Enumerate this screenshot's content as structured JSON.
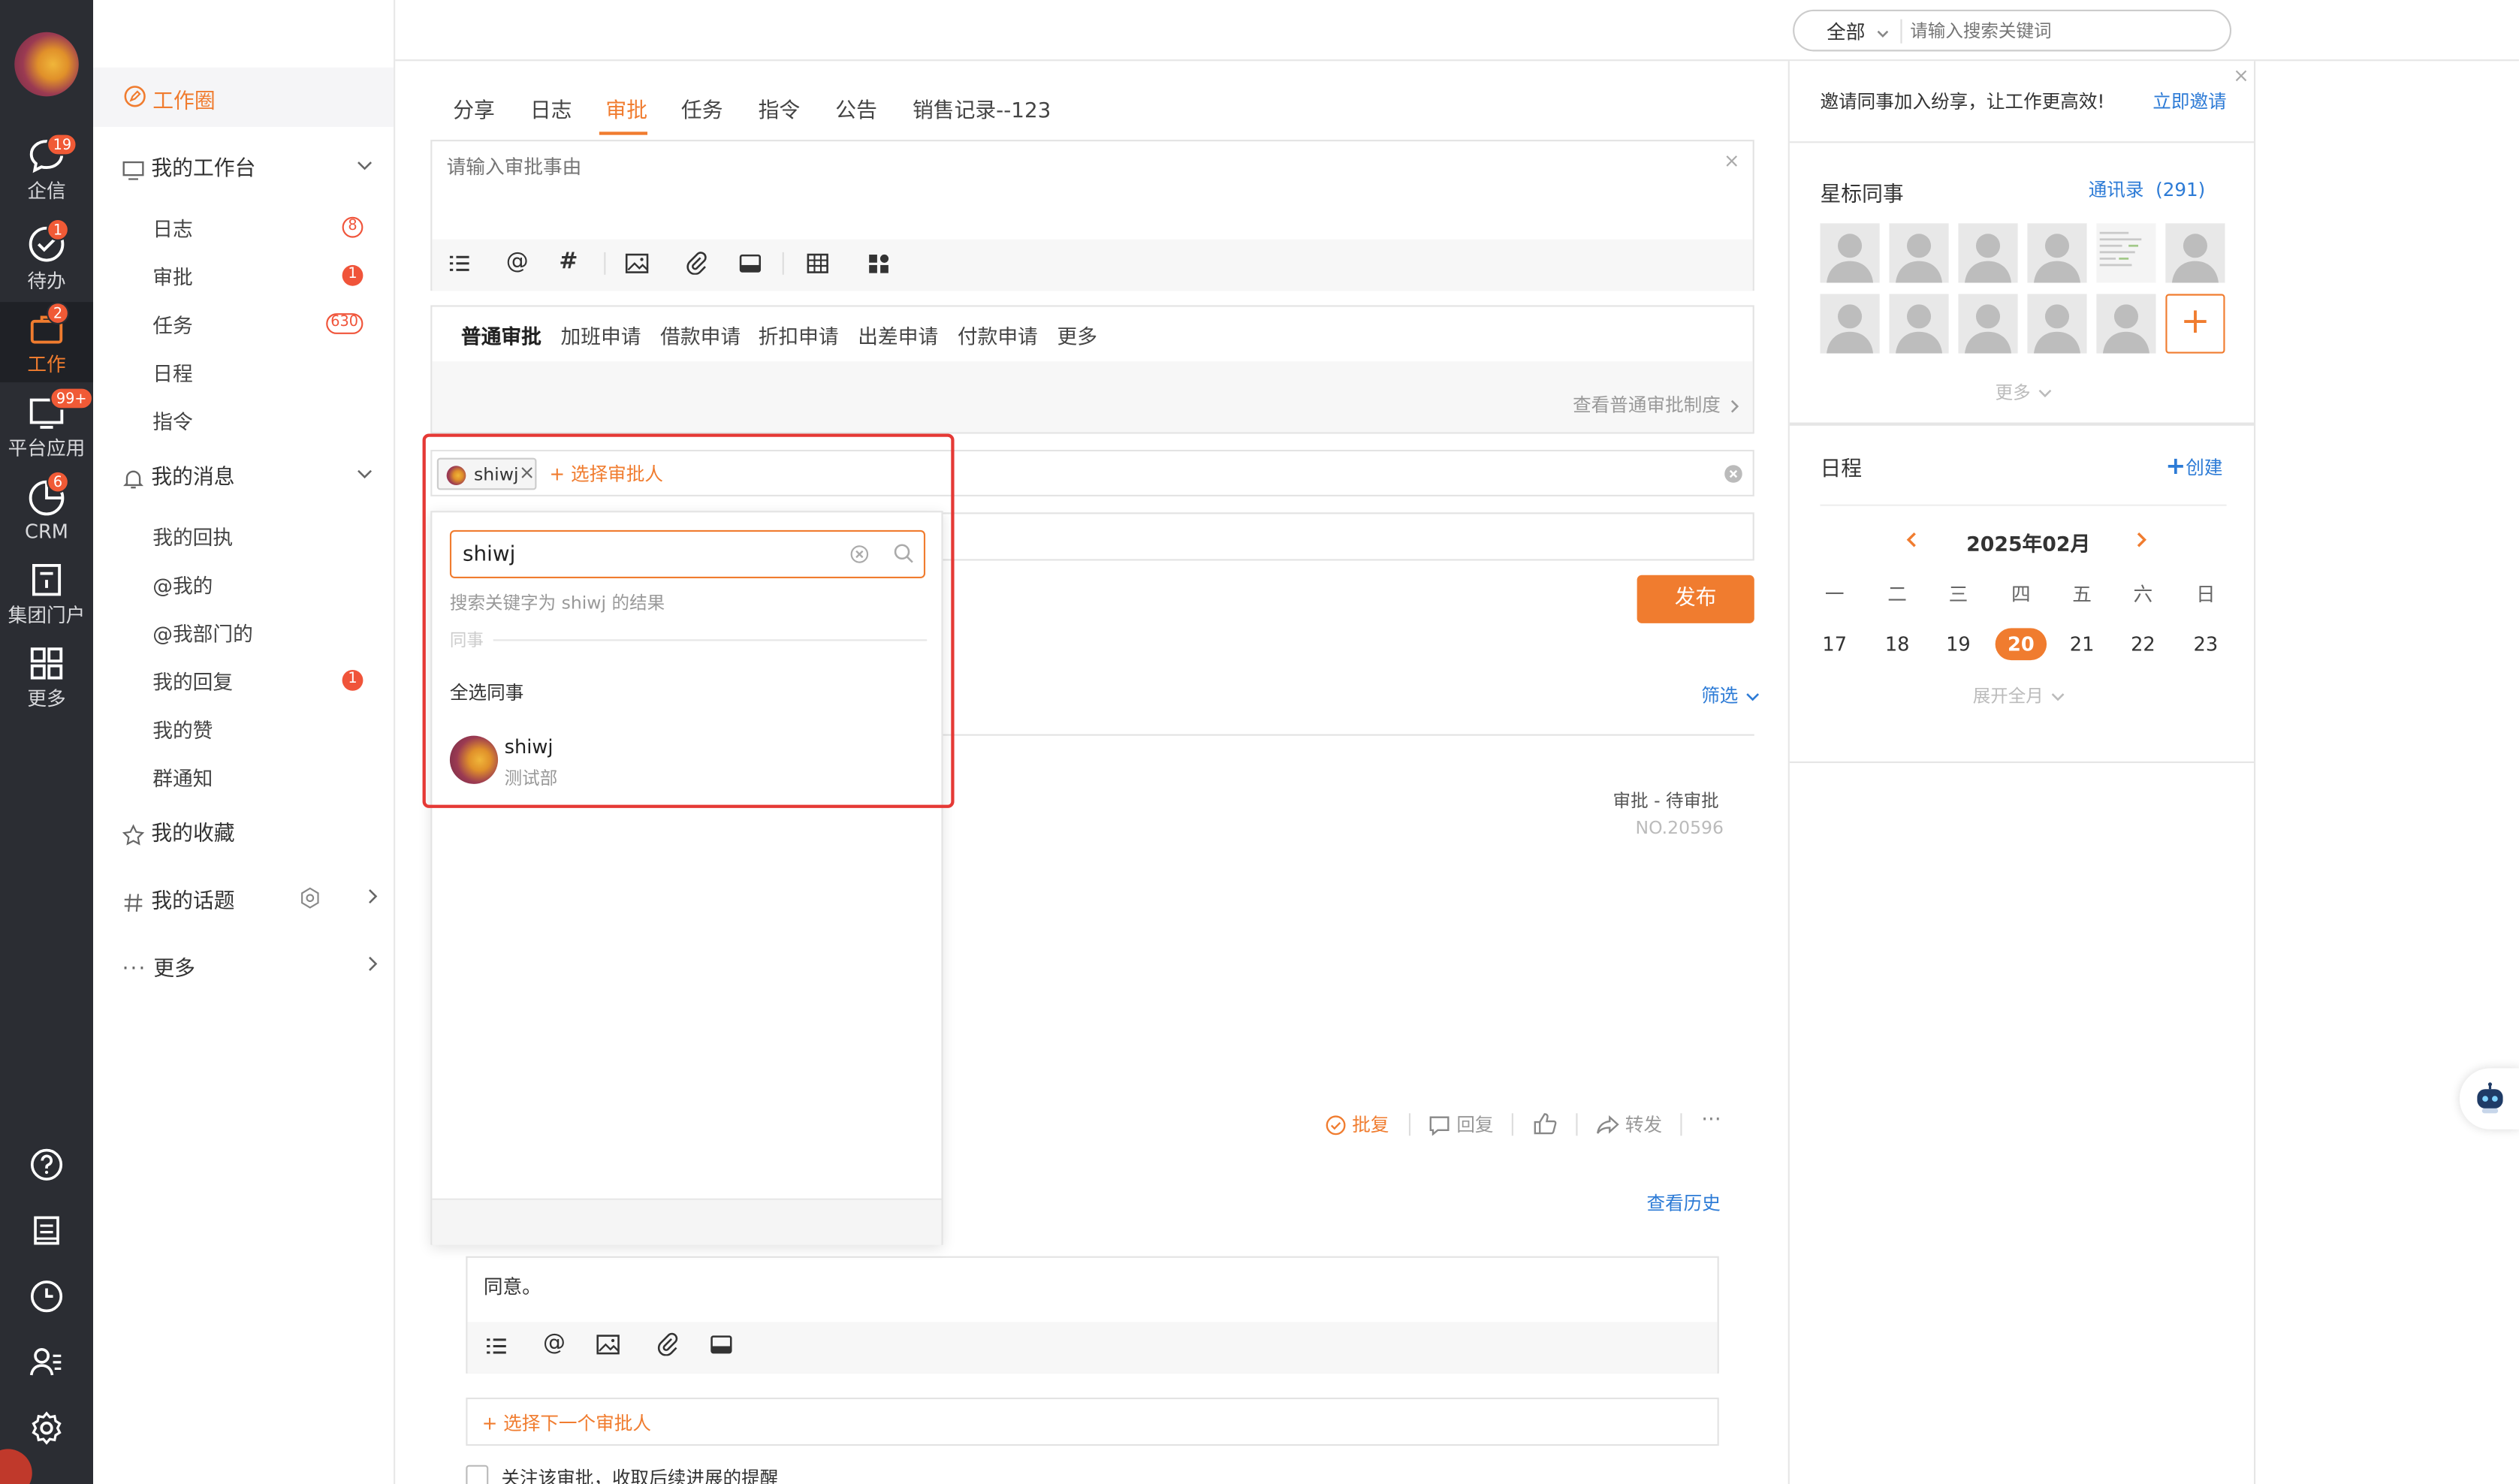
{
  "topbar": {
    "title": "工作",
    "scope_select": "全部",
    "search_placeholder": "请输入搜索关键词"
  },
  "rail": {
    "items": [
      {
        "label": "企信",
        "badge": "19"
      },
      {
        "label": "待办",
        "badge": "1"
      },
      {
        "label": "工作",
        "badge": "2"
      },
      {
        "label": "平台应用",
        "badge": "99+"
      },
      {
        "label": "CRM",
        "badge": "6"
      },
      {
        "label": "集团门户",
        "badge": ""
      },
      {
        "label": "更多",
        "badge": ""
      }
    ],
    "active": "工作"
  },
  "nav": {
    "circle": "工作圈",
    "workbench": "我的工作台",
    "workbench_items": [
      {
        "label": "日志",
        "badge": "8"
      },
      {
        "label": "审批",
        "badge": "1"
      },
      {
        "label": "任务",
        "badge": "630"
      },
      {
        "label": "日程",
        "badge": ""
      },
      {
        "label": "指令",
        "badge": ""
      }
    ],
    "messages": "我的消息",
    "message_items": [
      {
        "label": "我的回执",
        "badge": ""
      },
      {
        "label": "@我的",
        "badge": ""
      },
      {
        "label": "@我部门的",
        "badge": ""
      },
      {
        "label": "我的回复",
        "badge": "1"
      },
      {
        "label": "我的赞",
        "badge": ""
      },
      {
        "label": "群通知",
        "badge": ""
      }
    ],
    "favorites": "我的收藏",
    "topics": "我的话题",
    "more": "更多"
  },
  "main": {
    "tabs": [
      "分享",
      "日志",
      "审批",
      "任务",
      "指令",
      "公告",
      "销售记录--123"
    ],
    "active_tab": "审批",
    "reason_placeholder": "请输入审批事由",
    "approval_types": [
      "普通审批",
      "加班申请",
      "借款申请",
      "折扣申请",
      "出差申请",
      "付款申请",
      "更多"
    ],
    "view_rules": "查看普通审批制度",
    "approver_chip": "shiwj",
    "select_approver": "+ 选择审批人",
    "publish": "发布",
    "filter": "筛选",
    "feed_status": "审批 - 待审批",
    "feed_no": "NO.20596",
    "actions": {
      "approve": "批复",
      "reply": "回复",
      "forward": "转发"
    },
    "view_history": "查看历史",
    "comment_text": "同意。",
    "next_approver": "+ 选择下一个审批人",
    "follow_text": "关注该审批，收取后续进展的提醒"
  },
  "dropdown": {
    "search_value": "shiwj",
    "result_hint": "搜索关键字为 shiwj 的结果",
    "section": "同事",
    "select_all": "全选同事",
    "person_name": "shiwj",
    "person_dept": "测试部"
  },
  "rpanel": {
    "invite_text": "邀请同事加入纷享，让工作更高效!",
    "invite_link": "立即邀请",
    "starred_title": "星标同事",
    "contacts_link": "通讯录  (291)",
    "more": "更多",
    "schedule_title": "日程",
    "create": "创建",
    "month": "2025年02月",
    "weekdays": [
      "一",
      "二",
      "三",
      "四",
      "五",
      "六",
      "日"
    ],
    "days": [
      "17",
      "18",
      "19",
      "20",
      "21",
      "22",
      "23"
    ],
    "today": "20",
    "expand": "展开全月"
  },
  "colors": {
    "accent": "#f07c2f",
    "link": "#2d7bd6",
    "rail": "#2b2d33",
    "highlight": "#e53935"
  }
}
